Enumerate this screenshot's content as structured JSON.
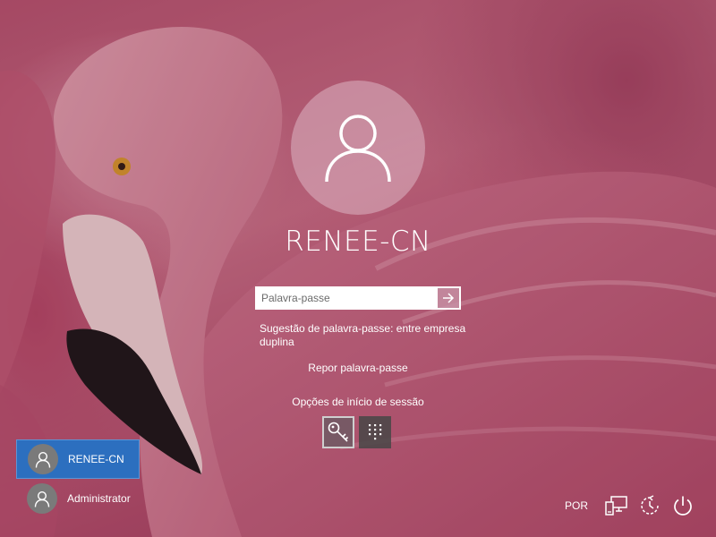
{
  "lock_screen": {
    "current_user": "RENEE-CN",
    "password": {
      "placeholder": "Palavra-passe",
      "value": ""
    },
    "password_hint": "Sugestão de palavra-passe: entre empresa duplina",
    "reset_password_label": "Repor palavra-passe",
    "signin_options_label": "Opções de início de sessão",
    "signin_options": [
      {
        "icon": "key-icon",
        "selected": true
      },
      {
        "icon": "pin-keypad-icon",
        "selected": false
      }
    ]
  },
  "user_list": [
    {
      "name": "RENEE-CN",
      "selected": true
    },
    {
      "name": "Administrator",
      "selected": false
    }
  ],
  "tray": {
    "language": "POR",
    "icons": [
      "network-icon",
      "ease-of-access-icon",
      "power-icon"
    ]
  },
  "colors": {
    "selected_user_bg": "#2c6fbf",
    "background_tint": "#c86f86"
  }
}
